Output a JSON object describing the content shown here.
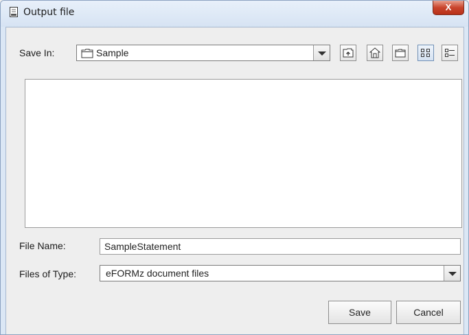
{
  "window": {
    "title": "Output file",
    "close_label": "X"
  },
  "save_in": {
    "label": "Save In:",
    "value": "Sample"
  },
  "toolbar": {
    "buttons": [
      "up-one-level",
      "home",
      "new-folder",
      "list-view",
      "details-view"
    ]
  },
  "file_name": {
    "label": "File Name:",
    "value": "SampleStatement"
  },
  "file_type": {
    "label": "Files of Type:",
    "value": "eFORMz document files"
  },
  "actions": {
    "save_label": "Save",
    "cancel_label": "Cancel"
  },
  "colors": {
    "close_button": "#c9452d",
    "window_border": "#8aa1c0",
    "panel_bg": "#eeeeee"
  }
}
